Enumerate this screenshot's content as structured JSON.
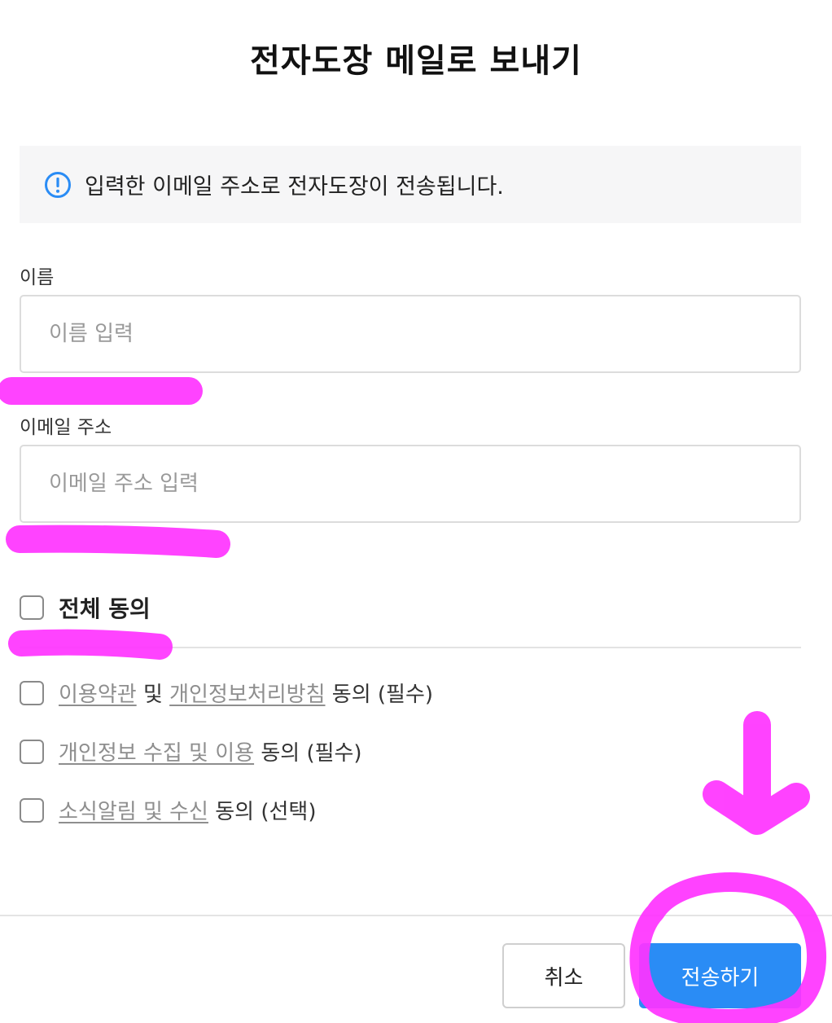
{
  "dialog": {
    "title": "전자도장 메일로 보내기",
    "notice": "입력한 이메일 주소로 전자도장이 전송됩니다."
  },
  "form": {
    "name_label": "이름",
    "name_placeholder": "이름 입력",
    "name_value": "",
    "email_label": "이메일 주소",
    "email_placeholder": "이메일 주소 입력",
    "email_value": ""
  },
  "agreements": {
    "all_label": "전체 동의",
    "all_checked": false,
    "items": [
      {
        "link1": "이용약관",
        "connector": " 및 ",
        "link2": "개인정보처리방침",
        "suffix": " 동의 (필수)",
        "checked": false
      },
      {
        "link1": "개인정보 수집 및 이용",
        "suffix": " 동의 (필수)",
        "checked": false
      },
      {
        "link1": "소식알림 및 수신",
        "suffix": " 동의 (선택)",
        "checked": false
      }
    ]
  },
  "buttons": {
    "cancel": "취소",
    "send": "전송하기"
  },
  "colors": {
    "accent": "#2a8cf5",
    "annotation": "#ff33ff"
  },
  "icons": {
    "notice": "info-circle-icon",
    "annotation_arrow": "down-arrow-icon"
  }
}
